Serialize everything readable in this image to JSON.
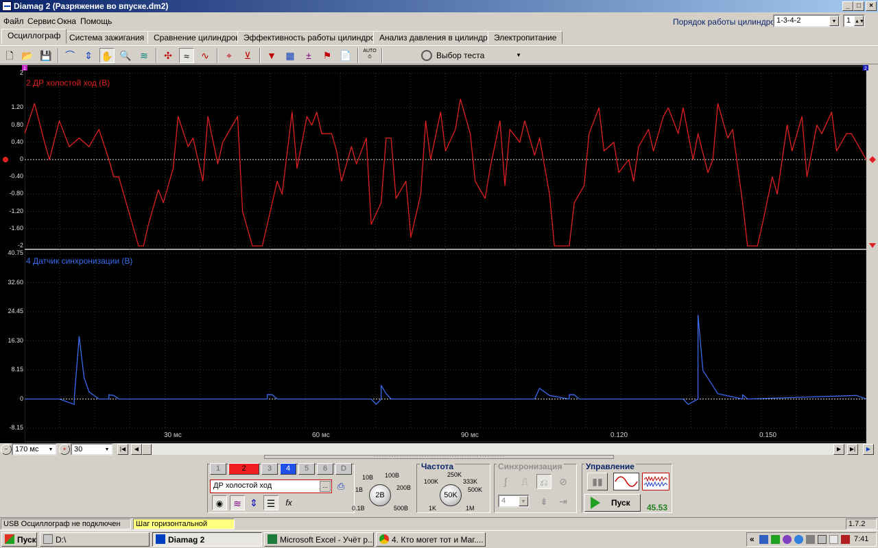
{
  "window": {
    "title": "Diamag 2 (Разряжение во впуске.dm2)"
  },
  "menu": [
    "Файл",
    "Сервис",
    "Окна",
    "Помощь"
  ],
  "cylinders": {
    "label": "Порядок работы цилиндров",
    "order": "1-3-4-2",
    "count": "1"
  },
  "tabs": [
    "Осциллограф",
    "Система зажигания",
    "Сравнение цилиндров",
    "Эффективность работы цилиндров",
    "Анализ давления в цилиндре",
    "Электропитание"
  ],
  "toolbar": {
    "test_select": "Выбор теста",
    "auto_label": "AUTO"
  },
  "scope": {
    "channel1": {
      "title": "2 ДР холостой ход (В)",
      "color": "#e02020",
      "yticks": [
        "2",
        "1.20",
        "0.80",
        "0.40",
        "0",
        "-0.40",
        "-0.80",
        "-1.20",
        "-1.60",
        "-2"
      ]
    },
    "channel2": {
      "title": "4 Датчик синхронизации (В)",
      "color": "#3a6cf0",
      "yticks": [
        "40.75",
        "32.60",
        "24.45",
        "16.30",
        "8.15",
        "0",
        "-8.15"
      ]
    },
    "xticks": [
      "30 мс",
      "60 мс",
      "90 мс",
      "0.120",
      "0.150"
    ],
    "marker1": "1",
    "marker2": "2"
  },
  "timebase": {
    "value": "170  мс",
    "offset": "30"
  },
  "channels_bar": [
    "1",
    "2",
    "3",
    "4",
    "5",
    "6",
    "D"
  ],
  "channel_name": "ДР холостой ход",
  "channel_more": "...",
  "voltage": {
    "value": "2В",
    "labels": [
      "10В",
      "100В",
      "1В",
      "200В",
      "0.1В",
      "500В"
    ]
  },
  "frequency": {
    "title": "Частота",
    "value": "50K",
    "labels": [
      "250K",
      "100K",
      "333K",
      "500K",
      "1K",
      "1M"
    ]
  },
  "sync": {
    "title": "Синхронизация",
    "value": "4"
  },
  "control": {
    "title": "Управление",
    "start_label": "Пуск",
    "reading": "45.53"
  },
  "status": {
    "usb": "USB Осциллограф не подключен",
    "hint": "Шаг горизонтальной шкалы",
    "version": "1.7.2"
  },
  "taskbar": {
    "start": "Пуск",
    "tasks": [
      "D:\\",
      "Diamag 2",
      "Microsoft Excel - Учёт р...",
      "4. Кто могет тот и Маг...."
    ],
    "clock": "7:41"
  },
  "chart_data": [
    {
      "type": "line",
      "title": "2 ДР холостой ход (В)",
      "xlabel": "",
      "ylabel": "",
      "ylim": [
        -2,
        2
      ],
      "xlim": [
        0,
        0.17
      ],
      "series": [
        {
          "name": "2 ДР холостой ход (В)",
          "x": [
            0,
            0.002,
            0.004,
            0.005,
            0.007,
            0.009,
            0.011,
            0.013,
            0.015,
            0.017,
            0.018,
            0.019,
            0.021,
            0.023,
            0.024,
            0.025,
            0.027,
            0.028,
            0.03,
            0.031,
            0.033,
            0.034,
            0.036,
            0.037,
            0.039,
            0.04,
            0.042,
            0.043,
            0.044,
            0.046,
            0.047,
            0.048,
            0.049,
            0.051,
            0.052,
            0.054,
            0.055,
            0.057,
            0.058,
            0.059,
            0.06,
            0.062,
            0.063,
            0.064,
            0.066,
            0.067,
            0.069,
            0.07,
            0.072,
            0.073,
            0.074,
            0.075,
            0.077,
            0.078,
            0.08,
            0.081,
            0.082,
            0.084,
            0.085,
            0.087,
            0.088,
            0.09,
            0.091,
            0.093,
            0.094,
            0.096,
            0.097,
            0.098,
            0.1,
            0.101,
            0.103,
            0.104,
            0.106,
            0.107,
            0.109,
            0.11,
            0.111,
            0.113,
            0.114,
            0.116,
            0.117,
            0.119,
            0.12,
            0.122,
            0.123,
            0.124,
            0.126,
            0.127,
            0.129,
            0.13,
            0.132,
            0.133,
            0.135,
            0.136,
            0.138,
            0.139,
            0.14,
            0.142,
            0.143,
            0.145,
            0.146,
            0.148,
            0.149,
            0.151,
            0.152,
            0.154,
            0.155,
            0.157,
            0.158,
            0.16,
            0.161,
            0.163,
            0.164,
            0.166,
            0.167,
            0.17
          ],
          "y": [
            0.6,
            1.3,
            0.4,
            0.0,
            0.9,
            0.3,
            0.5,
            0.3,
            0.7,
            0.0,
            -0.4,
            -0.4,
            -1.2,
            -2.0,
            -2.0,
            -1.5,
            -0.7,
            -1.0,
            -0.2,
            1.0,
            0.3,
            0.5,
            -0.5,
            1.0,
            -0.1,
            0.4,
            0.8,
            1.0,
            -1.2,
            -2.0,
            -2.0,
            -2.0,
            -1.5,
            -0.5,
            -0.8,
            1.1,
            -0.2,
            1.0,
            0.8,
            1.1,
            0.6,
            0.6,
            0.2,
            -0.5,
            0.3,
            -0.1,
            0.5,
            -1.5,
            -1.0,
            0.5,
            0.5,
            -0.9,
            -0.5,
            -1.8,
            -0.8,
            0.9,
            0.0,
            1.1,
            0.2,
            0.7,
            1.4,
            0.6,
            -0.5,
            -0.9,
            -0.2,
            0.9,
            -0.6,
            0.7,
            0.4,
            0.9,
            0.1,
            0.5,
            -0.8,
            -2.0,
            -2.0,
            -2.0,
            -1.0,
            -0.6,
            0.6,
            1.2,
            0.2,
            0.4,
            -0.3,
            0.0,
            -0.5,
            0.3,
            0.7,
            0.2,
            1.0,
            1.2,
            0.6,
            1.2,
            0.0,
            0.6,
            -0.3,
            0.0,
            1.3,
            0.5,
            0.7,
            -1.0,
            -2.0,
            -2.0,
            -1.5,
            -0.4,
            -0.8,
            0.8,
            0.2,
            1.0,
            -0.4,
            0.8,
            0.6,
            1.1,
            0.2,
            0.6,
            0.6,
            0.0
          ]
        }
      ]
    },
    {
      "type": "line",
      "title": "4 Датчик синхронизации (В)",
      "xlabel": "",
      "ylabel": "",
      "ylim": [
        -8.15,
        40.75
      ],
      "xlim": [
        0,
        0.17
      ],
      "series": [
        {
          "name": "4 Датчик синхронизации (В)",
          "x": [
            0,
            0.007,
            0.01,
            0.01,
            0.011,
            0.012,
            0.013,
            0.015,
            0.017,
            0.017,
            0.018,
            0.019,
            0.049,
            0.049,
            0.05,
            0.051,
            0.07,
            0.071,
            0.072,
            0.072,
            0.073,
            0.074,
            0.103,
            0.104,
            0.106,
            0.11,
            0.11,
            0.111,
            0.112,
            0.133,
            0.134,
            0.136,
            0.136,
            0.137,
            0.14,
            0.145,
            0.145,
            0.146,
            0.168,
            0.17
          ],
          "y": [
            0,
            0,
            -1.5,
            0,
            17.5,
            6.0,
            2.0,
            0,
            0,
            1.2,
            1.0,
            0,
            0,
            1.2,
            1.2,
            0,
            0,
            -1.5,
            0,
            3.8,
            1.5,
            0,
            0,
            3.0,
            1.0,
            0,
            1.2,
            1.2,
            0,
            0,
            -1.5,
            0,
            23.5,
            8.0,
            1.5,
            0,
            1.2,
            0,
            1.0,
            0
          ]
        }
      ]
    }
  ]
}
